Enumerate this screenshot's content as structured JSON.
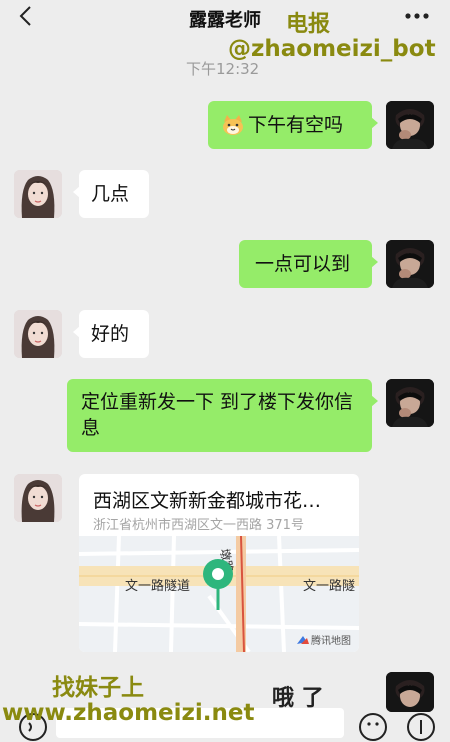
{
  "header": {
    "title": "露露老师",
    "back_icon": "chevron-left-icon",
    "more_icon": "ellipsis-icon"
  },
  "watermarks": {
    "top_line1": "电报",
    "top_line2": "@zhaomeizi_bot",
    "bottom_line1": "找妹子上",
    "bottom_line2": "www.zhaomeizi.net",
    "bottom_partial": "哦 了"
  },
  "timestamp": "下午12:32",
  "messages": [
    {
      "side": "me",
      "emoji": "cat-face-emoji",
      "text": "下午有空吗"
    },
    {
      "side": "her",
      "text": "几点"
    },
    {
      "side": "me",
      "text": "一点可以到"
    },
    {
      "side": "her",
      "text": "好的"
    },
    {
      "side": "me",
      "text": "定位重新发一下 到了楼下发你信息"
    }
  ],
  "location": {
    "title": "西湖区文新新金都城市花…",
    "address": "浙江省杭州市西湖区文一西路 371号",
    "map_road_left": "文一路隧道",
    "map_road_right": "文一路隧",
    "map_road_vertical": "墩路",
    "map_brand": "腾讯地图"
  },
  "colors": {
    "background": "#ededed",
    "bubble_me": "#95ec69",
    "bubble_her": "#ffffff",
    "pin": "#2eb67d",
    "watermark": "#8a8a10"
  }
}
